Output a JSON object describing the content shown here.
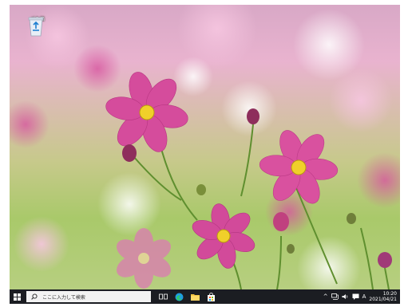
{
  "desktop": {
    "recycle_bin_label": "ごみ箱"
  },
  "taskbar": {
    "search_placeholder": "ここに入力して検索",
    "tray": {
      "chevron": "^",
      "ime": "A",
      "time": "10:20",
      "date": "2021/04/21"
    }
  },
  "colors": {
    "taskbar": "#1b1d22",
    "accent": "#0a84d8",
    "flower_pink": "#d64d9b"
  }
}
